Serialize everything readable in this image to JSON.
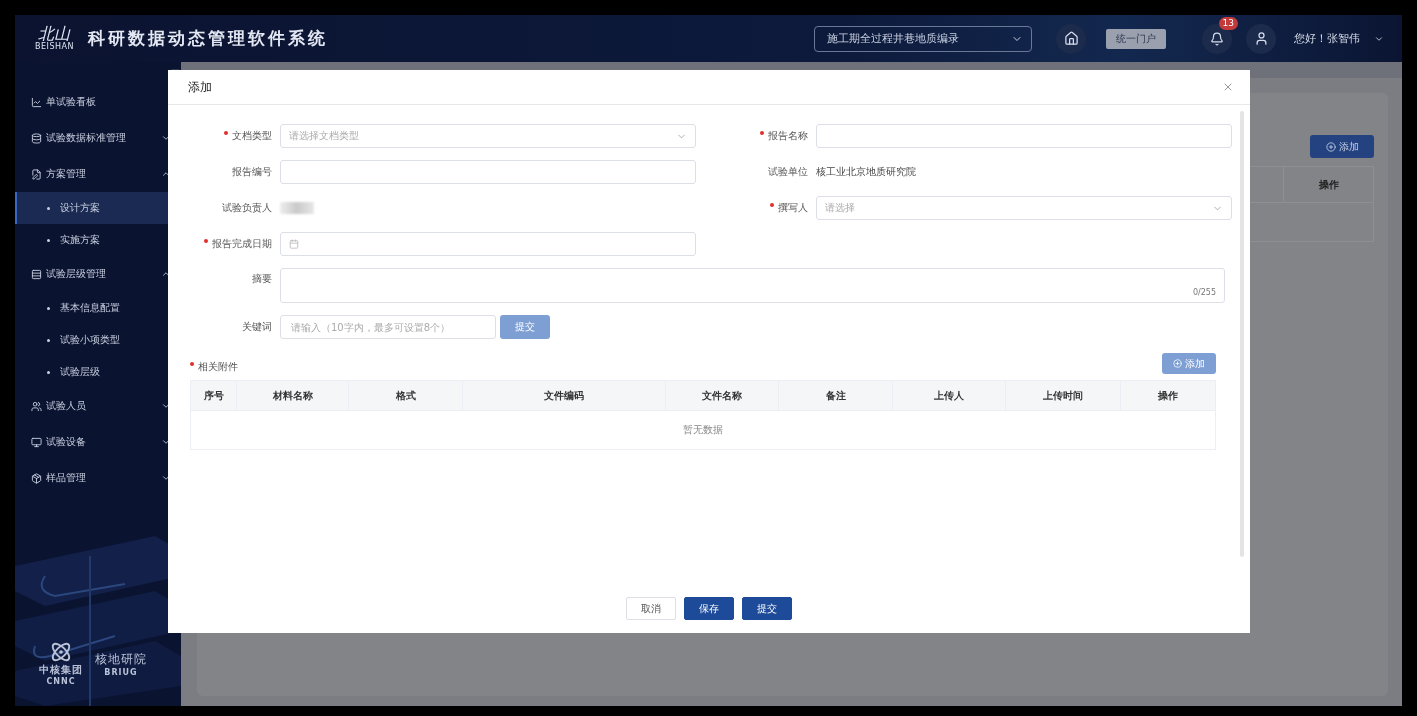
{
  "header": {
    "logo_text": "北山",
    "logo_subtext": "BEISHAN",
    "title": "科研数据动态管理软件系统",
    "project_select": {
      "value": "施工期全过程井巷地质编录"
    },
    "portal_button": "统一门户",
    "notifications": {
      "count": "13"
    },
    "greeting": "您好！张智伟"
  },
  "sidebar": {
    "items": [
      {
        "label": "单试验看板",
        "kind": "link",
        "selected": false
      },
      {
        "label": "试验数据标准管理",
        "kind": "group",
        "expanded": false,
        "selected": false
      },
      {
        "label": "方案管理",
        "kind": "group",
        "expanded": true,
        "selected": false,
        "children": [
          {
            "label": "设计方案",
            "selected": true
          },
          {
            "label": "实施方案",
            "selected": false
          }
        ]
      },
      {
        "label": "试验层级管理",
        "kind": "group",
        "expanded": true,
        "selected": false,
        "children": [
          {
            "label": "基本信息配置",
            "selected": false
          },
          {
            "label": "试验小项类型",
            "selected": false
          },
          {
            "label": "试验层级",
            "selected": false
          }
        ]
      },
      {
        "label": "试验人员",
        "kind": "group",
        "expanded": false,
        "selected": false
      },
      {
        "label": "试验设备",
        "kind": "group",
        "expanded": false,
        "selected": false
      },
      {
        "label": "样品管理",
        "kind": "group",
        "expanded": false,
        "selected": false
      }
    ],
    "footer": {
      "group_name": "中核集团",
      "group_code": "CNNC",
      "institute_name": "核地研院",
      "institute_code": "BRIUG"
    }
  },
  "background": {
    "add_button": "添加",
    "table_columns": [
      "操作"
    ]
  },
  "modal": {
    "title": "添加",
    "fields": [
      {
        "label": "文档类型",
        "kind": "select",
        "required": true,
        "placeholder": "请选择文档类型"
      },
      {
        "label": "报告名称",
        "kind": "input",
        "required": true
      },
      {
        "label": "报告编号",
        "kind": "input",
        "required": false
      },
      {
        "label": "试验单位",
        "kind": "text",
        "required": false,
        "value": "核工业北京地质研究院"
      },
      {
        "label": "试验负责人",
        "kind": "masked",
        "required": false
      },
      {
        "label": "撰写人",
        "kind": "select",
        "required": true,
        "placeholder": "请选择"
      },
      {
        "label": "报告完成日期",
        "kind": "date",
        "required": true
      },
      {
        "label": "摘要",
        "kind": "textarea",
        "required": false,
        "counter": "0/255"
      },
      {
        "label": "关键词",
        "kind": "keywords",
        "required": false,
        "placeholder": "请输入（10字内，最多可设置8个）",
        "button": "提交"
      }
    ],
    "attachments": {
      "label": "相关附件",
      "required": true,
      "add_button": "添加",
      "columns": [
        "序号",
        "材料名称",
        "格式",
        "文件编码",
        "文件名称",
        "备注",
        "上传人",
        "上传时间",
        "操作"
      ],
      "empty_text": "暂无数据"
    },
    "buttons": [
      {
        "label": "取消",
        "kind": "default"
      },
      {
        "label": "保存",
        "kind": "primary"
      },
      {
        "label": "提交",
        "kind": "primary"
      }
    ]
  }
}
